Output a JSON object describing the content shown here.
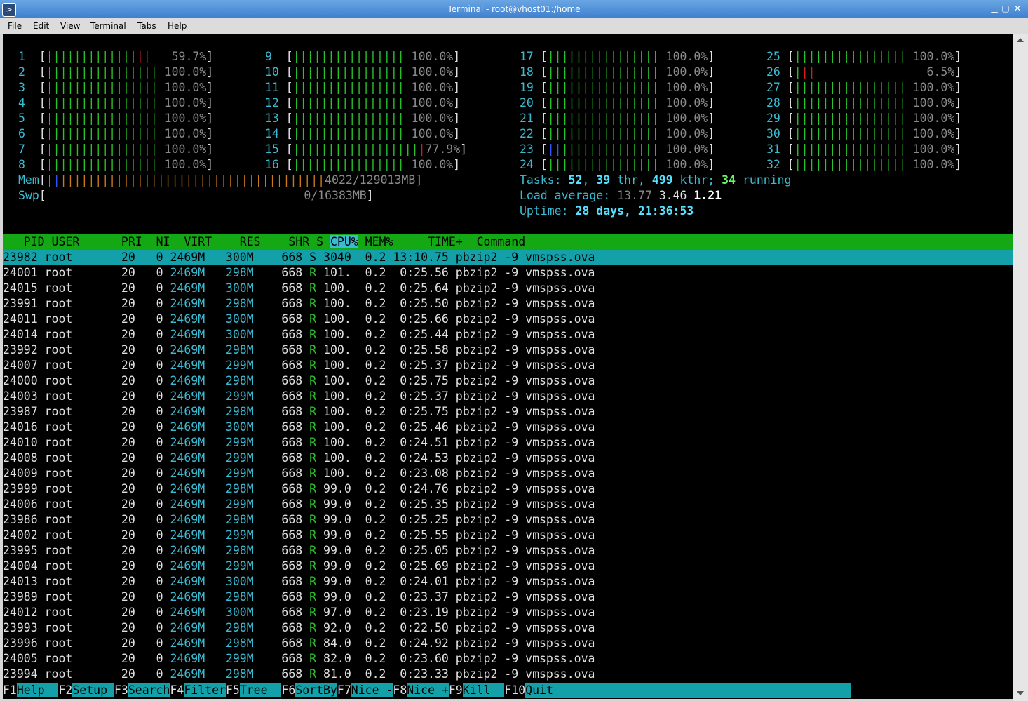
{
  "window": {
    "title": "Terminal - root@vhost01:/home",
    "icon": "terminal-icon",
    "btn_min": "▁",
    "btn_max": "▢",
    "btn_close": "✕"
  },
  "menu": [
    "File",
    "Edit",
    "View",
    "Terminal",
    "Tabs",
    "Help"
  ],
  "cpus": [
    {
      "n": "1",
      "pct": "59.7%",
      "g": 13,
      "r": 2,
      "b": 0
    },
    {
      "n": "2",
      "pct": "100.0%",
      "g": 16,
      "r": 0,
      "b": 0
    },
    {
      "n": "3",
      "pct": "100.0%",
      "g": 16,
      "r": 0,
      "b": 0
    },
    {
      "n": "4",
      "pct": "100.0%",
      "g": 16,
      "r": 0,
      "b": 0
    },
    {
      "n": "5",
      "pct": "100.0%",
      "g": 16,
      "r": 0,
      "b": 0
    },
    {
      "n": "6",
      "pct": "100.0%",
      "g": 16,
      "r": 0,
      "b": 0
    },
    {
      "n": "7",
      "pct": "100.0%",
      "g": 16,
      "r": 0,
      "b": 0
    },
    {
      "n": "8",
      "pct": "100.0%",
      "g": 16,
      "r": 0,
      "b": 0
    },
    {
      "n": "9",
      "pct": "100.0%",
      "g": 16,
      "r": 0,
      "b": 0
    },
    {
      "n": "10",
      "pct": "100.0%",
      "g": 16,
      "r": 0,
      "b": 0
    },
    {
      "n": "11",
      "pct": "100.0%",
      "g": 16,
      "r": 0,
      "b": 0
    },
    {
      "n": "12",
      "pct": "100.0%",
      "g": 16,
      "r": 0,
      "b": 0
    },
    {
      "n": "13",
      "pct": "100.0%",
      "g": 16,
      "r": 0,
      "b": 0
    },
    {
      "n": "14",
      "pct": "100.0%",
      "g": 16,
      "r": 0,
      "b": 0
    },
    {
      "n": "15",
      "pct": "77.9%",
      "g": 18,
      "r": 1,
      "b": 0
    },
    {
      "n": "16",
      "pct": "100.0%",
      "g": 16,
      "r": 0,
      "b": 0
    },
    {
      "n": "17",
      "pct": "100.0%",
      "g": 16,
      "r": 0,
      "b": 0
    },
    {
      "n": "18",
      "pct": "100.0%",
      "g": 16,
      "r": 0,
      "b": 0
    },
    {
      "n": "19",
      "pct": "100.0%",
      "g": 16,
      "r": 0,
      "b": 0
    },
    {
      "n": "20",
      "pct": "100.0%",
      "g": 16,
      "r": 0,
      "b": 0
    },
    {
      "n": "21",
      "pct": "100.0%",
      "g": 16,
      "r": 0,
      "b": 0
    },
    {
      "n": "22",
      "pct": "100.0%",
      "g": 16,
      "r": 0,
      "b": 0
    },
    {
      "n": "23",
      "pct": "100.0%",
      "g": 14,
      "r": 0,
      "b": 2
    },
    {
      "n": "24",
      "pct": "100.0%",
      "g": 16,
      "r": 0,
      "b": 0
    },
    {
      "n": "25",
      "pct": "100.0%",
      "g": 16,
      "r": 0,
      "b": 0
    },
    {
      "n": "26",
      "pct": "6.5%",
      "g": 1,
      "r": 2,
      "b": 0
    },
    {
      "n": "27",
      "pct": "100.0%",
      "g": 16,
      "r": 0,
      "b": 0
    },
    {
      "n": "28",
      "pct": "100.0%",
      "g": 16,
      "r": 0,
      "b": 0
    },
    {
      "n": "29",
      "pct": "100.0%",
      "g": 16,
      "r": 0,
      "b": 0
    },
    {
      "n": "30",
      "pct": "100.0%",
      "g": 16,
      "r": 0,
      "b": 0
    },
    {
      "n": "31",
      "pct": "100.0%",
      "g": 16,
      "r": 0,
      "b": 0
    },
    {
      "n": "32",
      "pct": "100.0%",
      "g": 16,
      "r": 0,
      "b": 0
    }
  ],
  "mem": {
    "label": "Mem",
    "value": "4022/129013MB"
  },
  "swp": {
    "label": "Swp",
    "value": "0/16383MB"
  },
  "tasks": {
    "label": "Tasks:",
    "count": "52",
    "thr": "39",
    "thr_label": "thr,",
    "kthr": "499",
    "kthr_label": "kthr;",
    "running": "34",
    "running_label": "running"
  },
  "load": {
    "label": "Load average:",
    "l1": "13.77",
    "l5": "3.46",
    "l15": "1.21"
  },
  "uptime": {
    "label": "Uptime:",
    "value": "28 days, 21:36:53"
  },
  "header": {
    "pid": "PID",
    "user": "USER",
    "pri": "PRI",
    "ni": "NI",
    "virt": "VIRT",
    "res": "RES",
    "shr": "SHR",
    "s": "S",
    "cpu": "CPU%",
    "mem": "MEM%",
    "time": "TIME+",
    "cmd": "Command"
  },
  "processes": [
    {
      "pid": "23982",
      "user": "root",
      "pri": "20",
      "ni": "0",
      "virt": "2469M",
      "res": "300M",
      "shr": "668",
      "s": "S",
      "cpu": "3040",
      "mem": "0.2",
      "time": "13:10.75",
      "cmd": "pbzip2",
      "args": "-9 vmspss.ova"
    },
    {
      "pid": "24001",
      "user": "root",
      "pri": "20",
      "ni": "0",
      "virt": "2469M",
      "res": "298M",
      "shr": "668",
      "s": "R",
      "cpu": "101.",
      "mem": "0.2",
      "time": "0:25.56",
      "cmd": "pbzip2",
      "args": "-9 vmspss.ova"
    },
    {
      "pid": "24015",
      "user": "root",
      "pri": "20",
      "ni": "0",
      "virt": "2469M",
      "res": "300M",
      "shr": "668",
      "s": "R",
      "cpu": "100.",
      "mem": "0.2",
      "time": "0:25.64",
      "cmd": "pbzip2",
      "args": "-9 vmspss.ova"
    },
    {
      "pid": "23991",
      "user": "root",
      "pri": "20",
      "ni": "0",
      "virt": "2469M",
      "res": "298M",
      "shr": "668",
      "s": "R",
      "cpu": "100.",
      "mem": "0.2",
      "time": "0:25.50",
      "cmd": "pbzip2",
      "args": "-9 vmspss.ova"
    },
    {
      "pid": "24011",
      "user": "root",
      "pri": "20",
      "ni": "0",
      "virt": "2469M",
      "res": "300M",
      "shr": "668",
      "s": "R",
      "cpu": "100.",
      "mem": "0.2",
      "time": "0:25.66",
      "cmd": "pbzip2",
      "args": "-9 vmspss.ova"
    },
    {
      "pid": "24014",
      "user": "root",
      "pri": "20",
      "ni": "0",
      "virt": "2469M",
      "res": "300M",
      "shr": "668",
      "s": "R",
      "cpu": "100.",
      "mem": "0.2",
      "time": "0:25.44",
      "cmd": "pbzip2",
      "args": "-9 vmspss.ova"
    },
    {
      "pid": "23992",
      "user": "root",
      "pri": "20",
      "ni": "0",
      "virt": "2469M",
      "res": "298M",
      "shr": "668",
      "s": "R",
      "cpu": "100.",
      "mem": "0.2",
      "time": "0:25.58",
      "cmd": "pbzip2",
      "args": "-9 vmspss.ova"
    },
    {
      "pid": "24007",
      "user": "root",
      "pri": "20",
      "ni": "0",
      "virt": "2469M",
      "res": "299M",
      "shr": "668",
      "s": "R",
      "cpu": "100.",
      "mem": "0.2",
      "time": "0:25.37",
      "cmd": "pbzip2",
      "args": "-9 vmspss.ova"
    },
    {
      "pid": "24000",
      "user": "root",
      "pri": "20",
      "ni": "0",
      "virt": "2469M",
      "res": "298M",
      "shr": "668",
      "s": "R",
      "cpu": "100.",
      "mem": "0.2",
      "time": "0:25.75",
      "cmd": "pbzip2",
      "args": "-9 vmspss.ova"
    },
    {
      "pid": "24003",
      "user": "root",
      "pri": "20",
      "ni": "0",
      "virt": "2469M",
      "res": "299M",
      "shr": "668",
      "s": "R",
      "cpu": "100.",
      "mem": "0.2",
      "time": "0:25.37",
      "cmd": "pbzip2",
      "args": "-9 vmspss.ova"
    },
    {
      "pid": "23987",
      "user": "root",
      "pri": "20",
      "ni": "0",
      "virt": "2469M",
      "res": "298M",
      "shr": "668",
      "s": "R",
      "cpu": "100.",
      "mem": "0.2",
      "time": "0:25.75",
      "cmd": "pbzip2",
      "args": "-9 vmspss.ova"
    },
    {
      "pid": "24016",
      "user": "root",
      "pri": "20",
      "ni": "0",
      "virt": "2469M",
      "res": "300M",
      "shr": "668",
      "s": "R",
      "cpu": "100.",
      "mem": "0.2",
      "time": "0:25.46",
      "cmd": "pbzip2",
      "args": "-9 vmspss.ova"
    },
    {
      "pid": "24010",
      "user": "root",
      "pri": "20",
      "ni": "0",
      "virt": "2469M",
      "res": "299M",
      "shr": "668",
      "s": "R",
      "cpu": "100.",
      "mem": "0.2",
      "time": "0:24.51",
      "cmd": "pbzip2",
      "args": "-9 vmspss.ova"
    },
    {
      "pid": "24008",
      "user": "root",
      "pri": "20",
      "ni": "0",
      "virt": "2469M",
      "res": "299M",
      "shr": "668",
      "s": "R",
      "cpu": "100.",
      "mem": "0.2",
      "time": "0:24.53",
      "cmd": "pbzip2",
      "args": "-9 vmspss.ova"
    },
    {
      "pid": "24009",
      "user": "root",
      "pri": "20",
      "ni": "0",
      "virt": "2469M",
      "res": "299M",
      "shr": "668",
      "s": "R",
      "cpu": "100.",
      "mem": "0.2",
      "time": "0:23.08",
      "cmd": "pbzip2",
      "args": "-9 vmspss.ova"
    },
    {
      "pid": "23999",
      "user": "root",
      "pri": "20",
      "ni": "0",
      "virt": "2469M",
      "res": "298M",
      "shr": "668",
      "s": "R",
      "cpu": "99.0",
      "mem": "0.2",
      "time": "0:24.76",
      "cmd": "pbzip2",
      "args": "-9 vmspss.ova"
    },
    {
      "pid": "24006",
      "user": "root",
      "pri": "20",
      "ni": "0",
      "virt": "2469M",
      "res": "299M",
      "shr": "668",
      "s": "R",
      "cpu": "99.0",
      "mem": "0.2",
      "time": "0:25.35",
      "cmd": "pbzip2",
      "args": "-9 vmspss.ova"
    },
    {
      "pid": "23986",
      "user": "root",
      "pri": "20",
      "ni": "0",
      "virt": "2469M",
      "res": "298M",
      "shr": "668",
      "s": "R",
      "cpu": "99.0",
      "mem": "0.2",
      "time": "0:25.25",
      "cmd": "pbzip2",
      "args": "-9 vmspss.ova"
    },
    {
      "pid": "24002",
      "user": "root",
      "pri": "20",
      "ni": "0",
      "virt": "2469M",
      "res": "299M",
      "shr": "668",
      "s": "R",
      "cpu": "99.0",
      "mem": "0.2",
      "time": "0:25.55",
      "cmd": "pbzip2",
      "args": "-9 vmspss.ova"
    },
    {
      "pid": "23995",
      "user": "root",
      "pri": "20",
      "ni": "0",
      "virt": "2469M",
      "res": "298M",
      "shr": "668",
      "s": "R",
      "cpu": "99.0",
      "mem": "0.2",
      "time": "0:25.05",
      "cmd": "pbzip2",
      "args": "-9 vmspss.ova"
    },
    {
      "pid": "24004",
      "user": "root",
      "pri": "20",
      "ni": "0",
      "virt": "2469M",
      "res": "299M",
      "shr": "668",
      "s": "R",
      "cpu": "99.0",
      "mem": "0.2",
      "time": "0:25.69",
      "cmd": "pbzip2",
      "args": "-9 vmspss.ova"
    },
    {
      "pid": "24013",
      "user": "root",
      "pri": "20",
      "ni": "0",
      "virt": "2469M",
      "res": "300M",
      "shr": "668",
      "s": "R",
      "cpu": "99.0",
      "mem": "0.2",
      "time": "0:24.01",
      "cmd": "pbzip2",
      "args": "-9 vmspss.ova"
    },
    {
      "pid": "23989",
      "user": "root",
      "pri": "20",
      "ni": "0",
      "virt": "2469M",
      "res": "298M",
      "shr": "668",
      "s": "R",
      "cpu": "99.0",
      "mem": "0.2",
      "time": "0:23.37",
      "cmd": "pbzip2",
      "args": "-9 vmspss.ova"
    },
    {
      "pid": "24012",
      "user": "root",
      "pri": "20",
      "ni": "0",
      "virt": "2469M",
      "res": "300M",
      "shr": "668",
      "s": "R",
      "cpu": "97.0",
      "mem": "0.2",
      "time": "0:23.19",
      "cmd": "pbzip2",
      "args": "-9 vmspss.ova"
    },
    {
      "pid": "23993",
      "user": "root",
      "pri": "20",
      "ni": "0",
      "virt": "2469M",
      "res": "298M",
      "shr": "668",
      "s": "R",
      "cpu": "92.0",
      "mem": "0.2",
      "time": "0:22.50",
      "cmd": "pbzip2",
      "args": "-9 vmspss.ova"
    },
    {
      "pid": "23996",
      "user": "root",
      "pri": "20",
      "ni": "0",
      "virt": "2469M",
      "res": "298M",
      "shr": "668",
      "s": "R",
      "cpu": "84.0",
      "mem": "0.2",
      "time": "0:24.92",
      "cmd": "pbzip2",
      "args": "-9 vmspss.ova"
    },
    {
      "pid": "24005",
      "user": "root",
      "pri": "20",
      "ni": "0",
      "virt": "2469M",
      "res": "299M",
      "shr": "668",
      "s": "R",
      "cpu": "82.0",
      "mem": "0.2",
      "time": "0:23.60",
      "cmd": "pbzip2",
      "args": "-9 vmspss.ova"
    },
    {
      "pid": "23994",
      "user": "root",
      "pri": "20",
      "ni": "0",
      "virt": "2469M",
      "res": "298M",
      "shr": "668",
      "s": "R",
      "cpu": "81.0",
      "mem": "0.2",
      "time": "0:23.33",
      "cmd": "pbzip2",
      "args": "-9 vmspss.ova"
    }
  ],
  "footer": [
    {
      "key": "F1",
      "label": "Help  "
    },
    {
      "key": "F2",
      "label": "Setup "
    },
    {
      "key": "F3",
      "label": "Search"
    },
    {
      "key": "F4",
      "label": "Filter"
    },
    {
      "key": "F5",
      "label": "Tree  "
    },
    {
      "key": "F6",
      "label": "SortBy"
    },
    {
      "key": "F7",
      "label": "Nice -"
    },
    {
      "key": "F8",
      "label": "Nice +"
    },
    {
      "key": "F9",
      "label": "Kill  "
    },
    {
      "key": "F10",
      "label": "Quit"
    }
  ],
  "colors": {
    "green": "#2ac12a",
    "cyan": "#3bbbd1",
    "header_bg": "#15a815",
    "select_bg": "#14a0a8"
  }
}
